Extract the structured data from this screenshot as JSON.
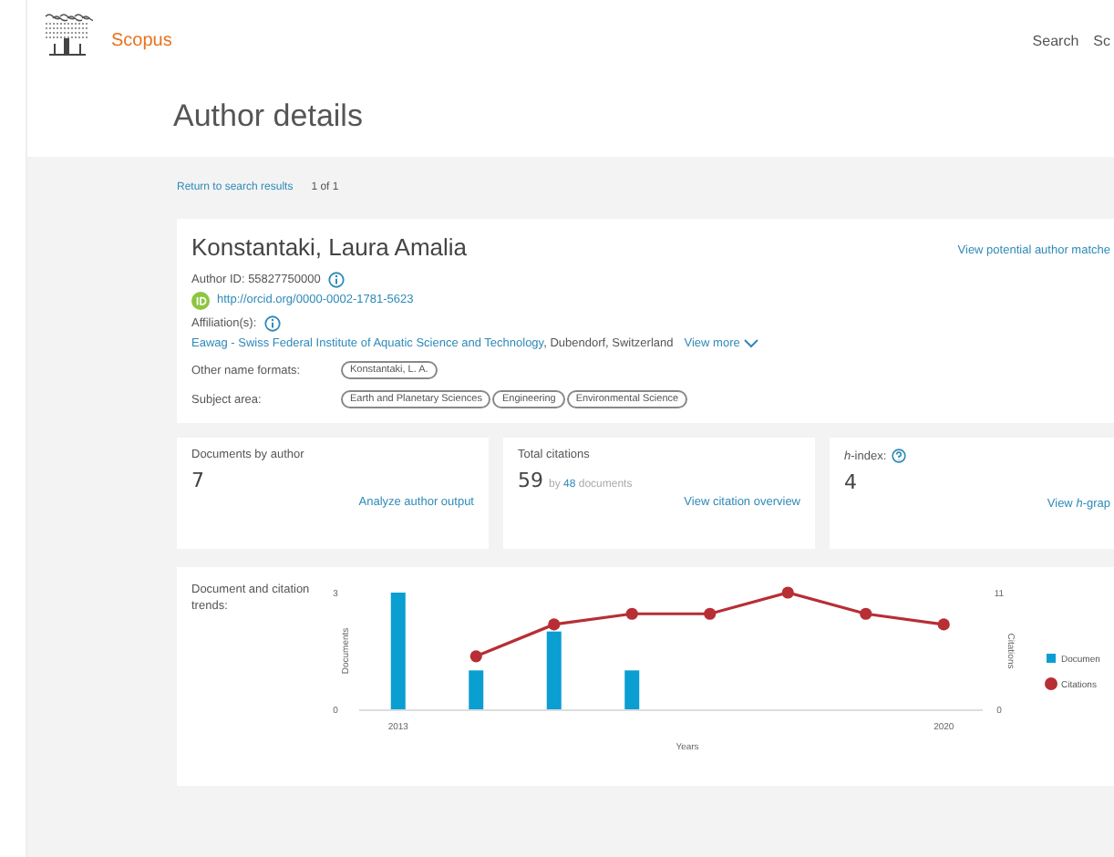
{
  "header": {
    "brand": "Scopus",
    "nav": [
      "Search",
      "Sc"
    ]
  },
  "page_title": "Author details",
  "breadcrumb": {
    "back_link": "Return to search results",
    "position": "1 of 1"
  },
  "author": {
    "name": "Konstantaki, Laura Amalia",
    "potential_matches_link": "View potential author matche",
    "author_id": "Author ID: 55827750000",
    "orcid_link": "http://orcid.org/0000-0002-1781-5623",
    "affiliation_label": "Affiliation(s):",
    "affiliation": "Eawag - Swiss Federal Institute of Aquatic Science and Technology",
    "affiliation_location": ", Dubendorf, Switzerland",
    "view_more": "View more",
    "other_names_label": "Other name formats:",
    "other_names": [
      "Konstantaki, L. A."
    ],
    "subject_label": "Subject area:",
    "subjects": [
      "Earth and Planetary Sciences",
      "Engineering",
      "Environmental Science"
    ]
  },
  "metrics": [
    {
      "kind": "documents",
      "label": "Documents by author",
      "value": "7",
      "link": "Analyze author output"
    },
    {
      "kind": "citations",
      "label": "Total citations",
      "value": "59",
      "by": "by",
      "documents_count": "48",
      "documents_word": "documents",
      "link": "View citation overview"
    },
    {
      "kind": "hindex",
      "label": "*h*-index:",
      "value": "4",
      "link": "View *h*-grap"
    }
  ],
  "trends": {
    "label": "Document and citation trends:",
    "chart_data": {
      "type": "bar",
      "xlabel": "Years",
      "ylabel": "Documents",
      "x": [
        2013,
        2014,
        2015,
        2016,
        2017,
        2018,
        2019,
        2020
      ],
      "series": [
        {
          "name": "Documen",
          "color": "#0a9ed1",
          "values": [
            3,
            1,
            2,
            1,
            0,
            0,
            0,
            0
          ]
        },
        {
          "name": "Citations",
          "type": "line",
          "marker": "circle",
          "axis": "y2",
          "color": "#b72e35",
          "values": [
            null,
            5,
            8,
            9,
            9,
            11,
            9,
            8
          ]
        }
      ],
      "xlim": [
        2012.5,
        2020.5
      ],
      "xticks": [
        2013,
        2020
      ],
      "ylim": [
        0,
        3
      ],
      "yticks": [
        0,
        3
      ],
      "y2label": "Citations",
      "y2lim": [
        0,
        11
      ],
      "y2ticks": [
        0,
        11
      ],
      "legend": true
    }
  }
}
